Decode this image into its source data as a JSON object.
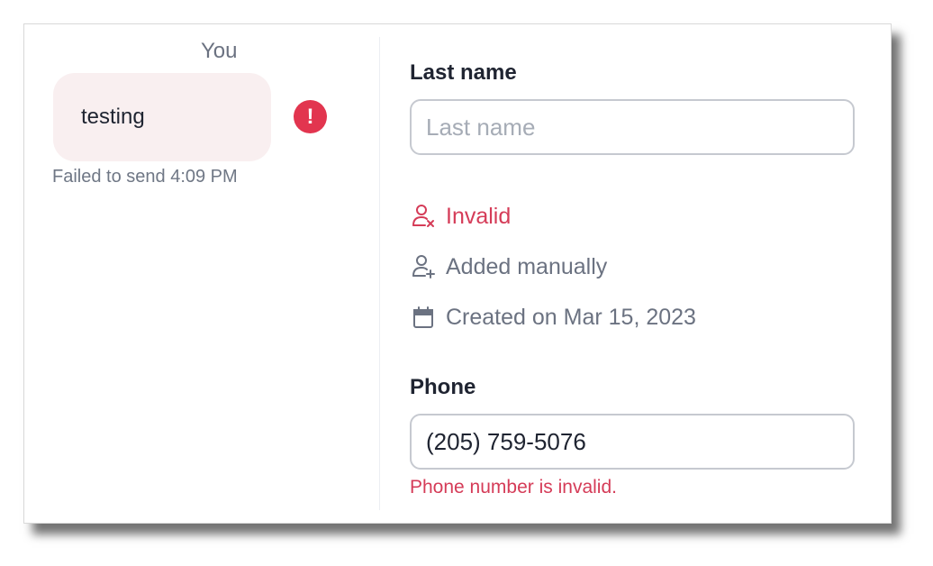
{
  "message": {
    "sender": "You",
    "text": "testing",
    "status": "Failed to send 4:09 PM",
    "error_icon": "exclamation-icon"
  },
  "last_name": {
    "label": "Last name",
    "placeholder": "Last name",
    "value": ""
  },
  "contact_meta": {
    "invalid": {
      "icon": "user-x-icon",
      "text": "Invalid"
    },
    "added": {
      "icon": "user-plus-icon",
      "text": "Added manually"
    },
    "created": {
      "icon": "calendar-icon",
      "text": "Created on Mar 15, 2023"
    }
  },
  "phone": {
    "label": "Phone",
    "value": "(205) 759-5076",
    "error": "Phone number is invalid."
  },
  "colors": {
    "error": "#d53c58",
    "bubble_bg": "#f9eff0",
    "badge": "#e2354f",
    "muted": "#6b7281"
  }
}
